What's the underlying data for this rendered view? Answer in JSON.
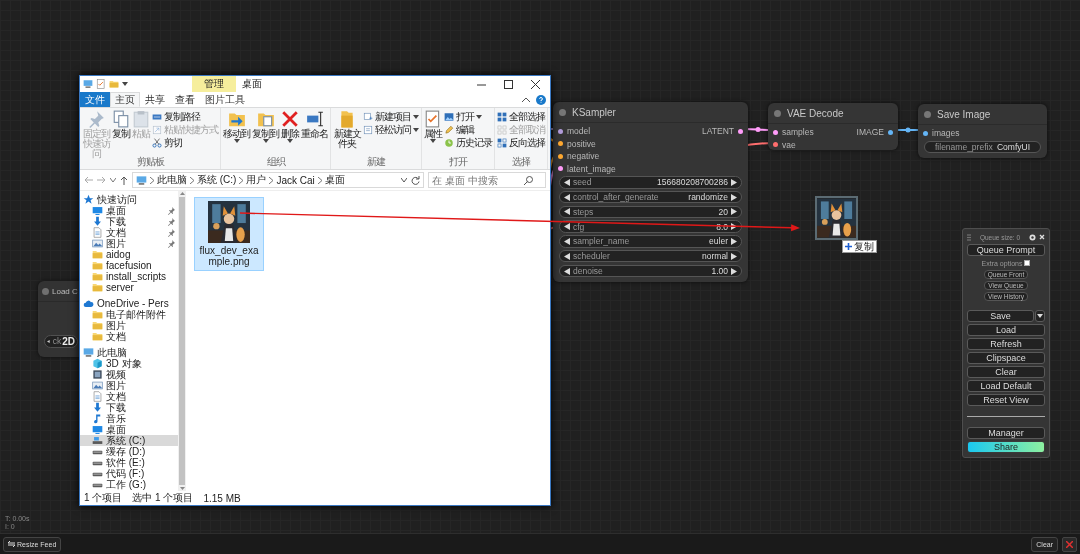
{
  "explorer": {
    "title": "桌面",
    "context_tab": "管理",
    "ribbon_tabs": [
      {
        "label": "文件",
        "kind": "file",
        "selected": false
      },
      {
        "label": "主页",
        "kind": "tab",
        "selected": true
      },
      {
        "label": "共享",
        "kind": "tab",
        "selected": false
      },
      {
        "label": "查看",
        "kind": "tab",
        "selected": false
      },
      {
        "label": "图片工具",
        "kind": "context",
        "selected": false
      }
    ],
    "ribbon_groups": [
      {
        "label": "剪贴板",
        "large_items": [
          {
            "label": "固定到快速访问",
            "kind": "pin",
            "dropdown": false,
            "disabled": true
          },
          {
            "label": "复制",
            "kind": "copy",
            "dropdown": false,
            "disabled": false
          },
          {
            "label": "粘贴",
            "kind": "paste",
            "dropdown": false,
            "disabled": true
          }
        ],
        "small_items": [
          {
            "label": "复制路径",
            "kind": "path",
            "dropdown": false,
            "disabled": false
          },
          {
            "label": "粘贴快捷方式",
            "kind": "shortcut",
            "dropdown": false,
            "disabled": true
          },
          {
            "label": "剪切",
            "kind": "cut",
            "dropdown": false,
            "disabled": false
          }
        ]
      },
      {
        "label": "组织",
        "large_items": [
          {
            "label": "移动到",
            "kind": "move",
            "dropdown": true,
            "disabled": false
          },
          {
            "label": "复制到",
            "kind": "copyto",
            "dropdown": true,
            "disabled": false
          },
          {
            "label": "删除",
            "kind": "delete",
            "dropdown": true,
            "disabled": false
          },
          {
            "label": "重命名",
            "kind": "rename",
            "dropdown": false,
            "disabled": false
          }
        ]
      },
      {
        "label": "新建",
        "large_items": [
          {
            "label": "新建文件夹",
            "kind": "newfolder",
            "dropdown": false,
            "disabled": false
          }
        ],
        "small_items": [
          {
            "label": "新建项目",
            "kind": "newitem",
            "dropdown": true,
            "disabled": false
          },
          {
            "label": "轻松访问",
            "kind": "easyaccess",
            "dropdown": true,
            "disabled": false
          }
        ]
      },
      {
        "label": "打开",
        "large_items": [
          {
            "label": "属性",
            "kind": "properties",
            "dropdown": true,
            "disabled": false
          }
        ],
        "small_items": [
          {
            "label": "打开",
            "kind": "open",
            "dropdown": true,
            "disabled": false
          },
          {
            "label": "编辑",
            "kind": "edit",
            "dropdown": false,
            "disabled": false
          },
          {
            "label": "历史记录",
            "kind": "history",
            "dropdown": false,
            "disabled": false
          }
        ]
      },
      {
        "label": "选择",
        "small_items": [
          {
            "label": "全部选择",
            "kind": "selectall",
            "dropdown": false,
            "disabled": false
          },
          {
            "label": "全部取消",
            "kind": "selectnone",
            "dropdown": false,
            "disabled": true
          },
          {
            "label": "反向选择",
            "kind": "invert",
            "dropdown": false,
            "disabled": false
          }
        ]
      }
    ],
    "address": [
      "此电脑",
      "系统 (C:)",
      "用户",
      "Jack Cai",
      "桌面"
    ],
    "search": {
      "placeholder": "在 桌面 中搜索"
    },
    "nav_tree": [
      {
        "label": "快速访问",
        "kind": "quick",
        "selected": false,
        "children": [
          {
            "label": "桌面",
            "kind": "desktop",
            "pinned": true,
            "selected": false
          },
          {
            "label": "下载",
            "kind": "download",
            "pinned": true,
            "selected": false
          },
          {
            "label": "文档",
            "kind": "document",
            "pinned": true,
            "selected": false
          },
          {
            "label": "图片",
            "kind": "pictures",
            "pinned": true,
            "selected": false
          },
          {
            "label": "aidog",
            "kind": "folder",
            "pinned": false,
            "selected": false
          },
          {
            "label": "facefusion",
            "kind": "folder",
            "pinned": false,
            "selected": false
          },
          {
            "label": "install_scripts",
            "kind": "folder",
            "pinned": false,
            "selected": false
          },
          {
            "label": "server",
            "kind": "folder",
            "pinned": false,
            "selected": false
          }
        ]
      },
      {
        "label": "OneDrive - Pers",
        "kind": "cloud",
        "selected": false,
        "children": [
          {
            "label": "电子邮件附件",
            "kind": "folder",
            "pinned": false,
            "selected": false
          },
          {
            "label": "图片",
            "kind": "folder",
            "pinned": false,
            "selected": false
          },
          {
            "label": "文档",
            "kind": "folder",
            "pinned": false,
            "selected": false
          }
        ]
      },
      {
        "label": "此电脑",
        "kind": "pc",
        "selected": false,
        "children": [
          {
            "label": "3D 对象",
            "kind": "objects3d",
            "pinned": false,
            "selected": false
          },
          {
            "label": "视频",
            "kind": "video",
            "pinned": false,
            "selected": false
          },
          {
            "label": "图片",
            "kind": "pictures",
            "pinned": false,
            "selected": false
          },
          {
            "label": "文档",
            "kind": "document",
            "pinned": false,
            "selected": false
          },
          {
            "label": "下载",
            "kind": "download",
            "pinned": false,
            "selected": false
          },
          {
            "label": "音乐",
            "kind": "music",
            "pinned": false,
            "selected": false
          },
          {
            "label": "桌面",
            "kind": "desktop",
            "pinned": false,
            "selected": false
          },
          {
            "label": "系统 (C:)",
            "kind": "system",
            "pinned": false,
            "selected": true
          },
          {
            "label": "缓存 (D:)",
            "kind": "drive",
            "pinned": false,
            "selected": false
          },
          {
            "label": "软件 (E:)",
            "kind": "drive",
            "pinned": false,
            "selected": false
          },
          {
            "label": "代码 (F:)",
            "kind": "drive",
            "pinned": false,
            "selected": false
          },
          {
            "label": "工作 (G:)",
            "kind": "drive",
            "pinned": false,
            "selected": false
          }
        ]
      }
    ],
    "files": [
      {
        "name": "flux_dev_example.png",
        "kind": "picture",
        "selected": true
      }
    ],
    "status": {
      "count": "1 个项目",
      "selection": "选中 1 个项目",
      "size": "1.15 MB"
    }
  },
  "nodes": [
    {
      "title": "Load C",
      "kind": "partial",
      "widgets": [
        {
          "name": "ck",
          "value": "2D",
          "kind": "overlay"
        }
      ]
    },
    {
      "title": "KSampler",
      "kind": "full",
      "inputs": [
        {
          "name": "model",
          "color": "#b39ddb"
        },
        {
          "name": "positive",
          "color": "#ffa931"
        },
        {
          "name": "negative",
          "color": "#ffa931"
        },
        {
          "name": "latent_image",
          "color": "#ff9cf9"
        }
      ],
      "outputs": [
        {
          "name": "LATENT",
          "color": "#ff9cf9"
        }
      ],
      "widgets": [
        {
          "name": "seed",
          "value": "156680208700286",
          "kind": "number"
        },
        {
          "name": "control_after_generate",
          "value": "randomize",
          "kind": "number"
        },
        {
          "name": "steps",
          "value": "20",
          "kind": "number"
        },
        {
          "name": "cfg",
          "value": "8.0",
          "kind": "number"
        },
        {
          "name": "sampler_name",
          "value": "euler",
          "kind": "number"
        },
        {
          "name": "scheduler",
          "value": "normal",
          "kind": "number"
        },
        {
          "name": "denoise",
          "value": "1.00",
          "kind": "number"
        }
      ]
    },
    {
      "title": "VAE Decode",
      "kind": "full",
      "inputs": [
        {
          "name": "samples",
          "color": "#ff9cf9"
        },
        {
          "name": "vae",
          "color": "#ff6e6e"
        }
      ],
      "outputs": [
        {
          "name": "IMAGE",
          "color": "#64b5f6"
        }
      ]
    },
    {
      "title": "Save Image",
      "kind": "full",
      "inputs": [
        {
          "name": "images",
          "color": "#64b5f6"
        }
      ],
      "widgets": [
        {
          "name": "filename_prefix",
          "value": "ComfyUI",
          "kind": "text"
        }
      ]
    }
  ],
  "drag_preview": {
    "kind": "picture",
    "badge": "复制"
  },
  "queue_panel": {
    "title": "Queue size: 0",
    "primary": "Queue Prompt",
    "extra_options": {
      "label": "Extra options",
      "checked": false
    },
    "small_buttons": [
      "Queue Front",
      "View Queue",
      "View History"
    ],
    "buttons": [
      {
        "label": "Save",
        "kind": "split"
      },
      {
        "label": "Load",
        "kind": "plain"
      },
      {
        "label": "Refresh",
        "kind": "plain"
      },
      {
        "label": "Clipspace",
        "kind": "plain"
      },
      {
        "label": "Clear",
        "kind": "plain"
      },
      {
        "label": "Load Default",
        "kind": "plain"
      },
      {
        "label": "Reset View",
        "kind": "plain"
      }
    ],
    "footer_buttons": [
      {
        "label": "Manager",
        "kind": "plain"
      },
      {
        "label": "Share",
        "kind": "gradient"
      }
    ]
  },
  "stats": [
    "T: 0.00s",
    "I: 0"
  ],
  "bottom_bar": {
    "resize_button": "Resize Feed",
    "clear_button": "Clear"
  }
}
